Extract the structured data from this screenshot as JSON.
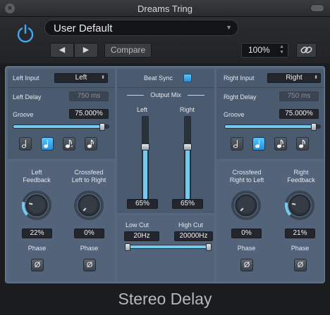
{
  "window": {
    "title": "Dreams Tring",
    "close_glyph": "×"
  },
  "header": {
    "preset_name": "User Default",
    "compare_label": "Compare",
    "zoom_value": "100%",
    "prev_glyph": "◀",
    "next_glyph": "▶"
  },
  "left": {
    "input_label": "Left Input",
    "input_value": "Left",
    "delay_label": "Left Delay",
    "delay_value": "750 ms",
    "groove_label": "Groove",
    "groove_value": "75.000%",
    "groove_level": 0.96,
    "note_active_index": 1,
    "feedback_label_1": "Left",
    "feedback_label_2": "Feedback",
    "feedback_value": "22%",
    "feedback_level": 0.22,
    "crossfeed_label_1": "Crossfeed",
    "crossfeed_label_2": "Left to Right",
    "crossfeed_value": "0%",
    "crossfeed_level": 0.0,
    "phase_label": "Phase",
    "phase_glyph": "Ø"
  },
  "center": {
    "beat_sync_label": "Beat Sync",
    "output_mix_label": "Output Mix",
    "left_label": "Left",
    "right_label": "Right",
    "left_value": "65%",
    "left_level": 0.65,
    "right_value": "65%",
    "right_level": 0.65,
    "low_cut_label": "Low Cut",
    "high_cut_label": "High Cut",
    "low_cut_value": "20Hz",
    "high_cut_value": "20000Hz"
  },
  "right": {
    "input_label": "Right Input",
    "input_value": "Right",
    "delay_label": "Right Delay",
    "delay_value": "750 ms",
    "groove_label": "Groove",
    "groove_value": "75.000%",
    "groove_level": 0.96,
    "note_active_index": 1,
    "crossfeed_label_1": "Crossfeed",
    "crossfeed_label_2": "Right to Left",
    "crossfeed_value": "0%",
    "crossfeed_level": 0.0,
    "feedback_label_1": "Right",
    "feedback_label_2": "Feedback",
    "feedback_value": "21%",
    "feedback_level": 0.21,
    "phase_label": "Phase",
    "phase_glyph": "Ø"
  },
  "footer": {
    "plugin_name": "Stereo Delay"
  },
  "colors": {
    "accent": "#76c9ee",
    "panel": "#56677e",
    "led": "#3fa9f5"
  }
}
